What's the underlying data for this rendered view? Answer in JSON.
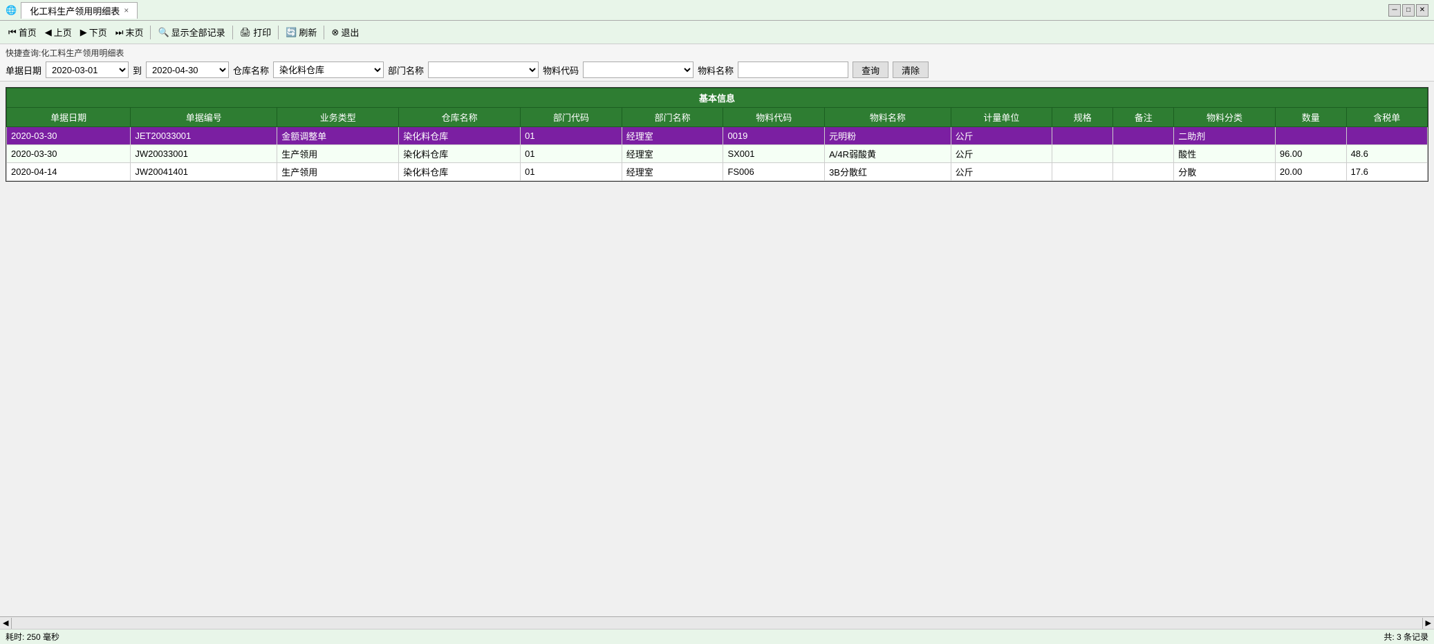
{
  "window": {
    "title": "化工料生产领用明细表",
    "tab_label": "化工料生产领用明细表",
    "close_label": "×"
  },
  "toolbar": {
    "buttons": [
      {
        "id": "first",
        "label": "首页",
        "icon": "⏮"
      },
      {
        "id": "prev",
        "label": "上页",
        "icon": "◀"
      },
      {
        "id": "next",
        "label": "下页",
        "icon": "▶"
      },
      {
        "id": "last",
        "label": "末页",
        "icon": "⏭"
      },
      {
        "id": "show_all",
        "label": "显示全部记录",
        "icon": "🔍"
      },
      {
        "id": "print",
        "label": "打印",
        "icon": "🖨"
      },
      {
        "id": "refresh",
        "label": "刷新",
        "icon": "🔄"
      },
      {
        "id": "exit",
        "label": "退出",
        "icon": "⊗"
      }
    ]
  },
  "search": {
    "title": "快捷查询:化工料生产领用明细表",
    "date_label": "单据日期",
    "to_label": "到",
    "warehouse_label": "仓库名称",
    "dept_label": "部门名称",
    "material_code_label": "物料代码",
    "material_name_label": "物料名称",
    "query_btn": "查询",
    "clear_btn": "清除",
    "date_from": "2020-03-01",
    "date_to": "2020-04-30",
    "warehouse_value": "染化料仓库",
    "dept_value": "",
    "material_code_value": "",
    "material_name_value": ""
  },
  "table": {
    "section_header": "基本信息",
    "columns": [
      "单据日期",
      "单据编号",
      "业务类型",
      "仓库名称",
      "部门代码",
      "部门名称",
      "物料代码",
      "物料名称",
      "计量单位",
      "规格",
      "备注",
      "物料分类",
      "数量",
      "含税单"
    ],
    "rows": [
      {
        "date": "2020-03-30",
        "bill_no": "JET20033001",
        "biz_type": "金额调整单",
        "warehouse": "染化料仓库",
        "dept_code": "01",
        "dept_name": "经理室",
        "material_code": "0019",
        "material_name": "元明粉",
        "unit": "公斤",
        "spec": "",
        "remark": "",
        "category": "二助剂",
        "qty": "",
        "tax_price": "",
        "selected": true
      },
      {
        "date": "2020-03-30",
        "bill_no": "JW20033001",
        "biz_type": "生产领用",
        "warehouse": "染化料仓库",
        "dept_code": "01",
        "dept_name": "经理室",
        "material_code": "SX001",
        "material_name": "A/4R弱酸黄",
        "unit": "公斤",
        "spec": "",
        "remark": "",
        "category": "酸性",
        "qty": "96.00",
        "tax_price": "48.6",
        "selected": false
      },
      {
        "date": "2020-04-14",
        "bill_no": "JW20041401",
        "biz_type": "生产领用",
        "warehouse": "染化料仓库",
        "dept_code": "01",
        "dept_name": "经理室",
        "material_code": "FS006",
        "material_name": "3B分散红",
        "unit": "公斤",
        "spec": "",
        "remark": "",
        "category": "分散",
        "qty": "20.00",
        "tax_price": "17.6",
        "selected": false
      }
    ]
  },
  "status": {
    "time_label": "耗时: 250 毫秒",
    "count_label": "共: 3 条记录"
  }
}
